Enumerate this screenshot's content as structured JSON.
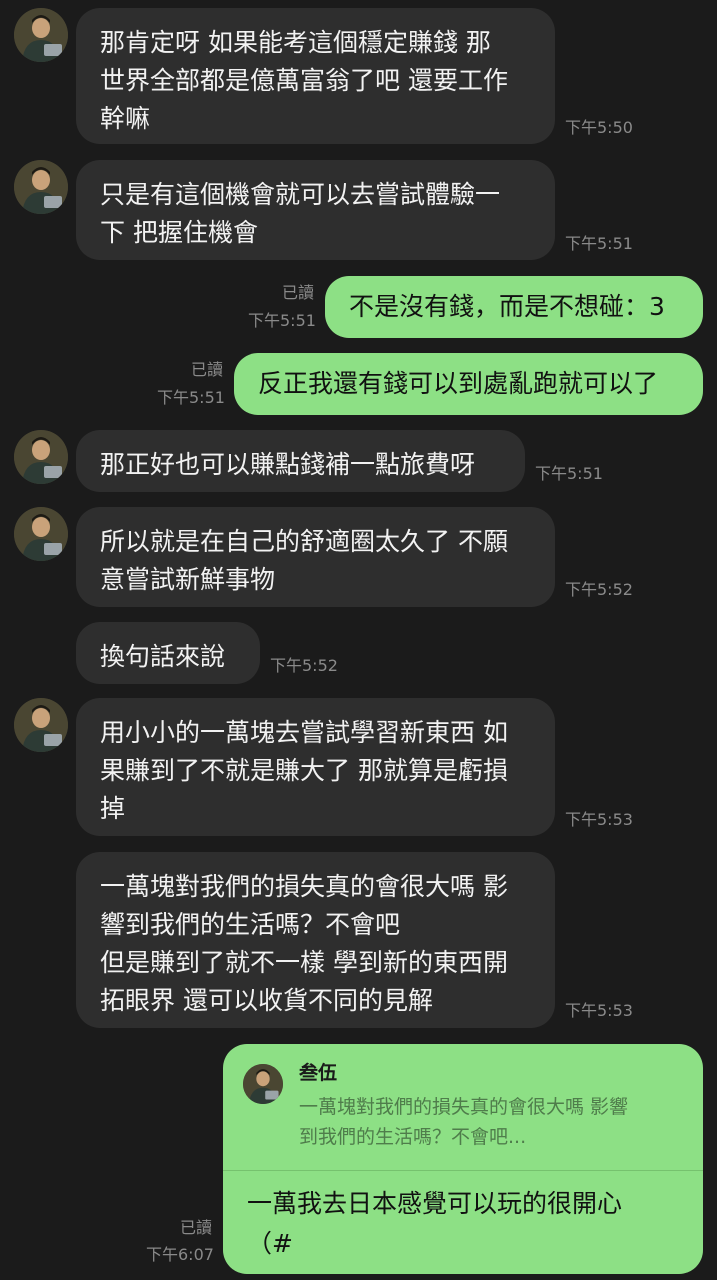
{
  "messages": [
    {
      "id": "m1",
      "side": "in",
      "lines": [
        "那肯定呀 如果能考這個穩定賺錢 那",
        "世界全部都是億萬富翁了吧 還要工作",
        "幹嘛"
      ],
      "time": "下午5:50"
    },
    {
      "id": "m2",
      "side": "in",
      "lines": [
        "只是有這個機會就可以去嘗試體驗一",
        "下 把握住機會"
      ],
      "time": "下午5:51"
    },
    {
      "id": "m3",
      "side": "out",
      "lines": [
        "不是沒有錢，而是不想碰：3"
      ],
      "time": "下午5:51",
      "read": "已讀"
    },
    {
      "id": "m4",
      "side": "out",
      "lines": [
        "反正我還有錢可以到處亂跑就可以了"
      ],
      "time": "下午5:51",
      "read": "已讀"
    },
    {
      "id": "m5",
      "side": "in",
      "lines": [
        "那正好也可以賺點錢補一點旅費呀"
      ],
      "time": "下午5:51"
    },
    {
      "id": "m6",
      "side": "in",
      "lines": [
        "所以就是在自己的舒適圈太久了 不願",
        "意嘗試新鮮事物"
      ],
      "time": "下午5:52"
    },
    {
      "id": "m7",
      "side": "in",
      "lines": [
        "換句話來說"
      ],
      "time": "下午5:52"
    },
    {
      "id": "m8",
      "side": "in",
      "lines": [
        "用小小的一萬塊去嘗試學習新東西 如",
        "果賺到了不就是賺大了 那就算是虧損",
        "掉"
      ],
      "time": "下午5:53"
    },
    {
      "id": "m9",
      "side": "in",
      "lines": [
        "一萬塊對我們的損失真的會很大嗎 影",
        "響到我們的生活嗎？不會吧",
        "但是賺到了就不一樣 學到新的東西開",
        "拓眼界 還可以收貨不同的見解"
      ],
      "time": "下午5:53"
    }
  ],
  "reply_message": {
    "quoted_name": "叁伍",
    "quoted_lines": [
      "一萬塊對我們的損失真的會很大嗎 影響",
      "到我們的生活嗎？不會吧..."
    ],
    "lines": [
      "一萬我去日本感覺可以玩的很開心",
      "（#"
    ],
    "time": "下午6:07",
    "read": "已讀"
  },
  "colors": {
    "background": "#1b1b1b",
    "incoming_bubble": "#2e2e2e",
    "outgoing_bubble": "#8de085",
    "timestamp": "#8a8a8a"
  },
  "icons": {
    "avatar": "avatar-photo"
  }
}
